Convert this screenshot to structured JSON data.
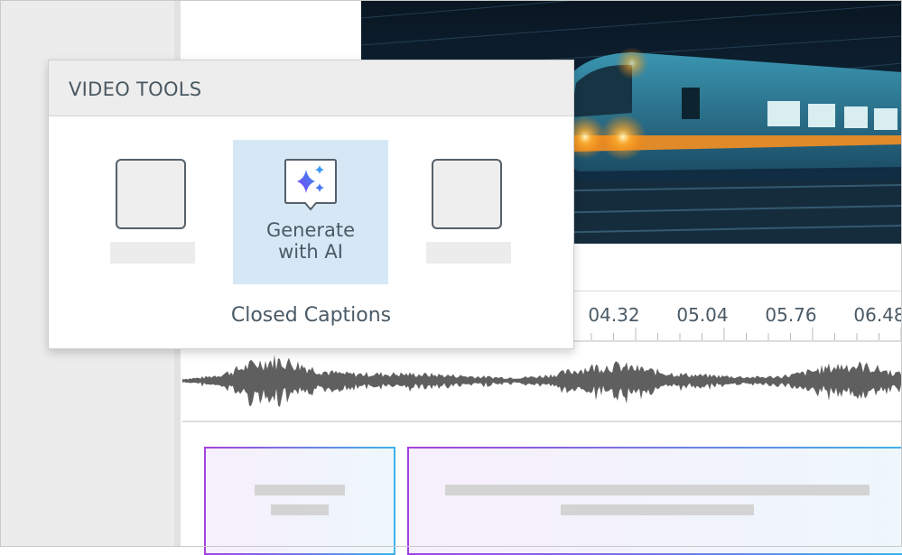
{
  "popup": {
    "title": "VIDEO TOOLS",
    "tools": [
      {
        "label": "",
        "selected": false,
        "icon": "placeholder-icon"
      },
      {
        "label_line1": "Generate",
        "label_line2": "with AI",
        "selected": true,
        "icon": "sparkle-caption-icon"
      },
      {
        "label": "",
        "selected": false,
        "icon": "placeholder-icon"
      }
    ],
    "section_label": "Closed Captions"
  },
  "timeline": {
    "tick_labels": [
      "04.32",
      "05.04",
      "05.76",
      "06.48"
    ]
  },
  "colors": {
    "accent_purple": "#a541e0",
    "accent_blue": "#3fb3e8",
    "selected_tile": "#d6e8f6",
    "waveform": "#5f5f5f"
  }
}
